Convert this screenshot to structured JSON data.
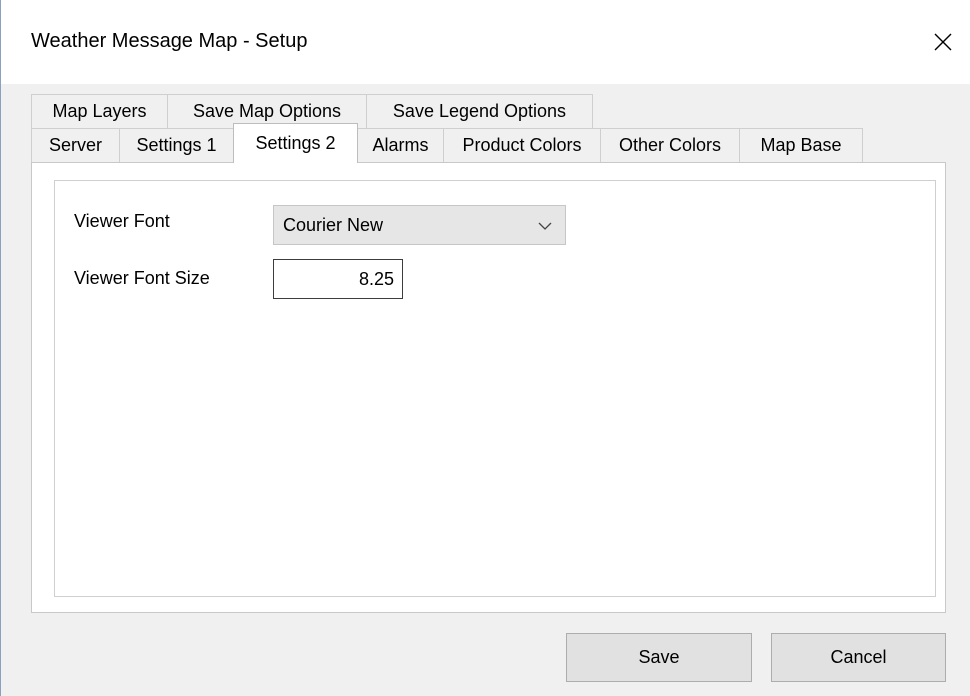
{
  "window": {
    "title": "Weather Message Map - Setup"
  },
  "tabs": {
    "row_top": [
      {
        "label": "Map Layers"
      },
      {
        "label": "Save Map Options"
      },
      {
        "label": "Save Legend Options"
      }
    ],
    "row_bottom": [
      {
        "label": "Server"
      },
      {
        "label": "Settings 1"
      },
      {
        "label": "Settings 2",
        "active": true
      },
      {
        "label": "Alarms"
      },
      {
        "label": "Product Colors"
      },
      {
        "label": "Other Colors"
      },
      {
        "label": "Map Base"
      }
    ]
  },
  "settings2": {
    "viewer_font_label": "Viewer Font",
    "viewer_font_value": "Courier New",
    "viewer_font_size_label": "Viewer Font Size",
    "viewer_font_size_value": "8.25"
  },
  "buttons": {
    "save": "Save",
    "cancel": "Cancel"
  },
  "icons": {
    "close": "close-icon",
    "dropdown": "chevron-down-icon"
  }
}
